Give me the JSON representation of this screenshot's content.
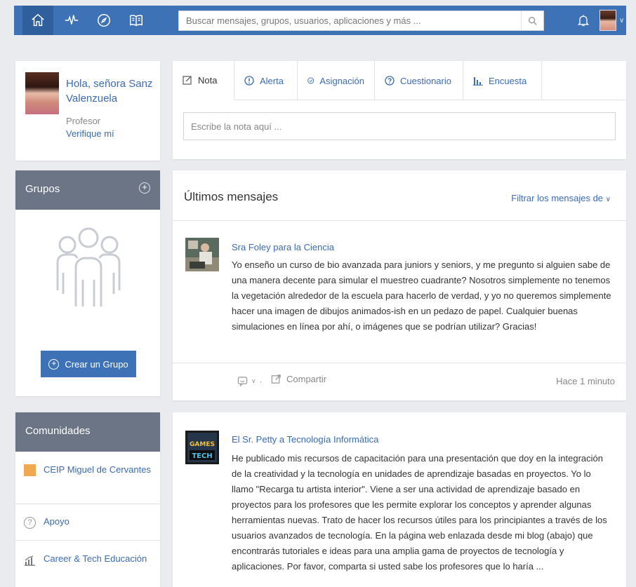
{
  "nav": {
    "home_icon": "home-icon",
    "activity_icon": "activity-icon",
    "discover_icon": "compass-icon",
    "library_icon": "book-icon"
  },
  "search": {
    "placeholder": "Buscar mensajes, grupos, usuarios, aplicaciones y más ..."
  },
  "colors": {
    "brand": "#3d72b6",
    "link": "#3b6bb1",
    "header_gray": "#6b7586",
    "page_bg": "#e9ebee"
  },
  "profile": {
    "greeting": "Hola, señora Sanz Valenzuela",
    "role": "Profesor",
    "verify": "Verifique mí"
  },
  "groups": {
    "title": "Grupos",
    "create_label": "Crear un Grupo"
  },
  "communities": {
    "title": "Comunidades",
    "items": [
      {
        "label": "CEIP Miguel de Cervantes",
        "icon": "school-icon"
      },
      {
        "label": "Apoyo",
        "icon": "question-icon"
      },
      {
        "label": "Career & Tech Educación",
        "icon": "chart-icon"
      }
    ]
  },
  "composer": {
    "tabs": [
      {
        "label": "Nota",
        "icon": "note-icon"
      },
      {
        "label": "Alerta",
        "icon": "alert-icon"
      },
      {
        "label": "Asignación",
        "icon": "check-icon"
      },
      {
        "label": "Cuestionario",
        "icon": "quiz-icon"
      },
      {
        "label": "Encuesta",
        "icon": "poll-icon"
      }
    ],
    "placeholder": "Escribe la nota aquí ..."
  },
  "feed": {
    "title": "Últimos mensajes",
    "filter": "Filtrar los mensajes de",
    "posts": [
      {
        "author": "Sra Foley para la Ciencia",
        "body": "Yo enseño un curso de bio avanzada para juniors y seniors, y me pregunto si alguien sabe de una manera decente para simular el muestreo cuadrante? Nosotros simplemente no tenemos la vegetación alrededor de la escuela para hacerlo de verdad, y yo no queremos simplemente hacer una imagen de dibujos animados-ish en un pedazo de papel. Cualquier buenas simulaciones en línea por ahí, o imágenes que se podrían utilizar? Gracias!",
        "share": "Compartir",
        "time": "Hace 1 minuto"
      },
      {
        "author": "El Sr. Petty a Tecnología Informática",
        "avatar_text_top": "GAMES",
        "avatar_text_bottom": "TECH",
        "body": "He publicado mis recursos de capacitación para una presentación que doy en la integración de la creatividad y la tecnología en unidades de aprendizaje basadas en proyectos. Yo lo llamo \"Recarga tu artista interior\". Viene a ser una actividad de aprendizaje basado en proyectos para los profesores que les permite explorar los conceptos y aprender algunas herramientas nuevas. Trato de hacer los recursos útiles para los principiantes a través de los usuarios avanzados de tecnología. En la página web enlazada desde mi blog (abajo) que encontrarás tutoriales e ideas para una amplia gama de proyectos de tecnología y aplicaciones. Por favor, comparta si usted sabe los profesores que lo haría ..."
      }
    ]
  }
}
